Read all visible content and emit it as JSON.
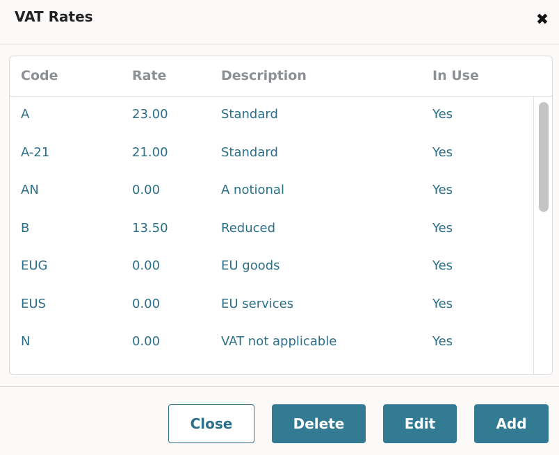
{
  "dialog": {
    "title": "VAT Rates",
    "close_icon": "close-icon"
  },
  "table": {
    "headers": {
      "code": "Code",
      "rate": "Rate",
      "description": "Description",
      "in_use": "In Use"
    },
    "rows": [
      {
        "code": "A",
        "rate": "23.00",
        "description": "Standard",
        "in_use": "Yes"
      },
      {
        "code": "A-21",
        "rate": "21.00",
        "description": "Standard",
        "in_use": "Yes"
      },
      {
        "code": "AN",
        "rate": "0.00",
        "description": "A notional",
        "in_use": "Yes"
      },
      {
        "code": "B",
        "rate": "13.50",
        "description": "Reduced",
        "in_use": "Yes"
      },
      {
        "code": "EUG",
        "rate": "0.00",
        "description": "EU goods",
        "in_use": "Yes"
      },
      {
        "code": "EUS",
        "rate": "0.00",
        "description": "EU services",
        "in_use": "Yes"
      },
      {
        "code": "N",
        "rate": "0.00",
        "description": "VAT not applicable",
        "in_use": "Yes"
      }
    ]
  },
  "footer": {
    "close_label": "Close",
    "delete_label": "Delete",
    "edit_label": "Edit",
    "add_label": "Add"
  },
  "colors": {
    "accent": "#337a93",
    "link_text": "#2b6f88",
    "header_text": "#8c9094"
  }
}
